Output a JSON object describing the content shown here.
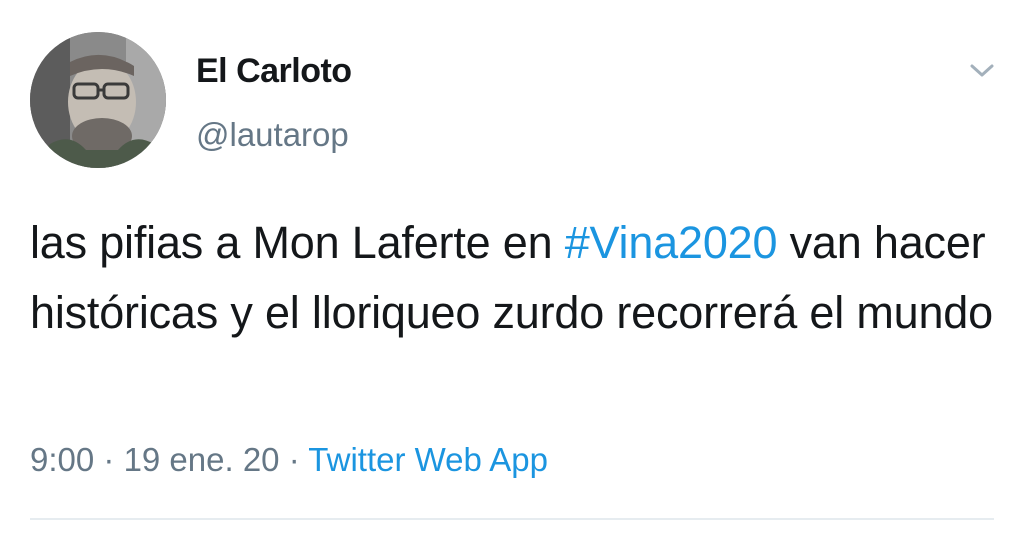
{
  "author": {
    "name": "El Carloto",
    "handle": "@lautarop"
  },
  "tweet": {
    "text_before": "las pifias a Mon Laferte en ",
    "hashtag": "#Vina2020",
    "text_after": " van hacer históricas y el lloriqueo zurdo recorrerá el mundo"
  },
  "meta": {
    "time": "9:00",
    "separator": " · ",
    "date": "19 ene. 20",
    "source": "Twitter Web App"
  },
  "icons": {
    "menu": "chevron-down-icon"
  },
  "colors": {
    "text": "#14171a",
    "secondary": "#657786",
    "link": "#1b95e0",
    "divider": "#e6ecf0"
  }
}
